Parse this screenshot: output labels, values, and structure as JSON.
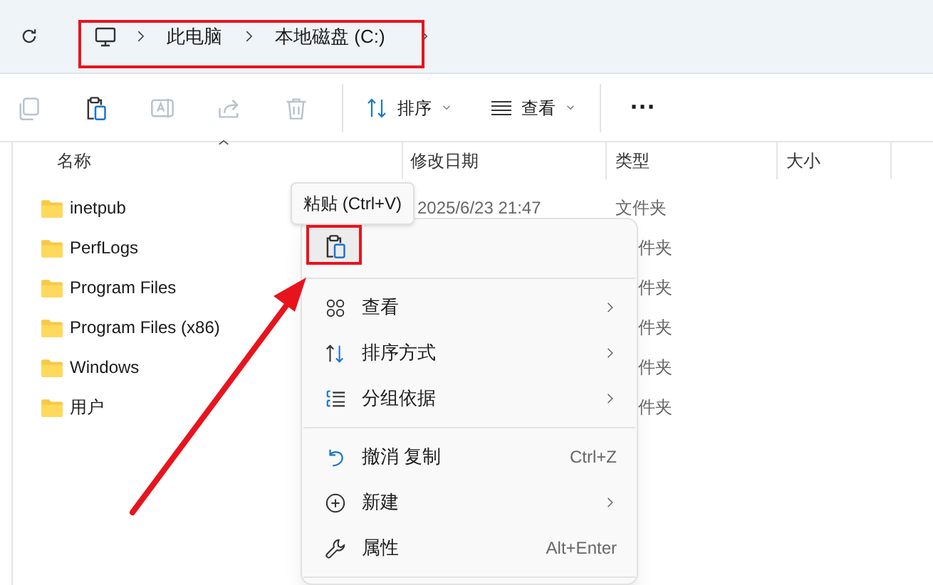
{
  "address_bar": {
    "breadcrumbs": [
      "此电脑",
      "本地磁盘 (C:)"
    ]
  },
  "toolbar": {
    "buttons": [
      {
        "kind": "copy",
        "disabled": true
      },
      {
        "kind": "paste",
        "disabled": false
      },
      {
        "kind": "rename",
        "disabled": true
      },
      {
        "kind": "share",
        "disabled": true
      },
      {
        "kind": "delete",
        "disabled": true
      }
    ],
    "sort": "排序",
    "view": "查看",
    "more": "⋯"
  },
  "columns": [
    "名称",
    "修改日期",
    "类型",
    "大小"
  ],
  "rows": [
    {
      "name": "inetpub",
      "date": "2025/6/23 21:47",
      "type": "文件夹"
    },
    {
      "name": "PerfLogs",
      "type": "件夹"
    },
    {
      "name": "Program Files",
      "type": "件夹"
    },
    {
      "name": "Program Files (x86)",
      "type": "件夹"
    },
    {
      "name": "Windows",
      "type": "件夹"
    },
    {
      "name": "用户",
      "type": "件夹"
    }
  ],
  "tooltip": "粘贴 (Ctrl+V)",
  "context_menu": {
    "groups": [
      [
        {
          "kind": "view",
          "label": "查看",
          "submenu": true
        },
        {
          "kind": "sort",
          "label": "排序方式",
          "submenu": true
        },
        {
          "kind": "group",
          "label": "分组依据",
          "submenu": true
        }
      ],
      [
        {
          "kind": "undo",
          "label": "撤消 复制",
          "shortcut": "Ctrl+Z",
          "submenu": false
        },
        {
          "kind": "new",
          "label": "新建",
          "submenu": true
        },
        {
          "kind": "properties",
          "label": "属性",
          "shortcut": "Alt+Enter",
          "submenu": false
        }
      ]
    ]
  }
}
